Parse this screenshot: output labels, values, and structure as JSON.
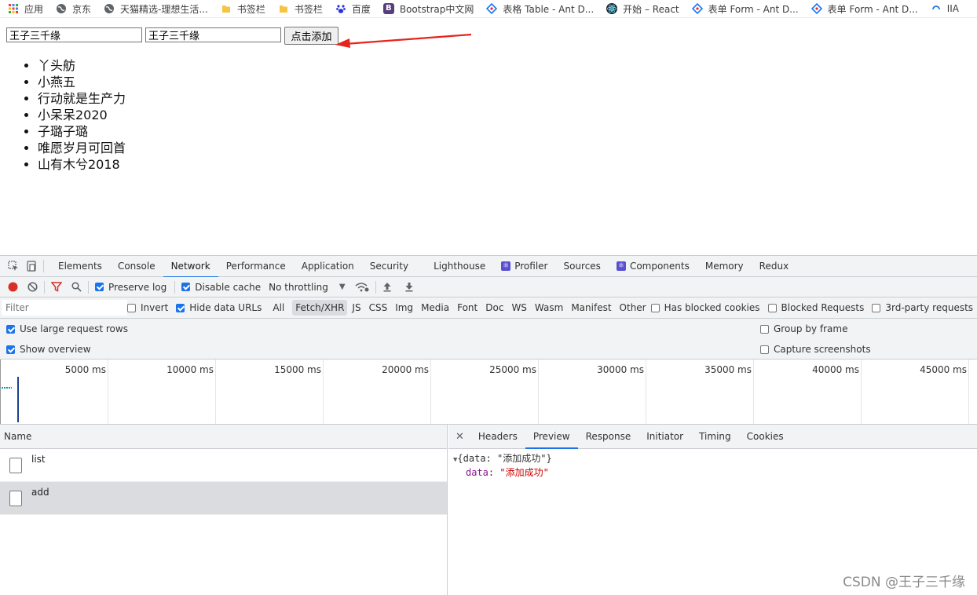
{
  "bookmarks": [
    {
      "label": "应用",
      "icon": "apps-grid-icon"
    },
    {
      "label": "京东",
      "icon": "globe-icon"
    },
    {
      "label": "天猫精选-理想生活...",
      "icon": "globe-icon"
    },
    {
      "label": "书签栏",
      "icon": "folder-icon"
    },
    {
      "label": "书签栏",
      "icon": "folder-icon"
    },
    {
      "label": "百度",
      "icon": "baidu-paw-icon"
    },
    {
      "label": "Bootstrap中文网",
      "icon": "bootstrap-icon"
    },
    {
      "label": "表格 Table - Ant D...",
      "icon": "ant-design-icon"
    },
    {
      "label": "开始 – React",
      "icon": "react-icon"
    },
    {
      "label": "表单 Form - Ant D...",
      "icon": "ant-design-icon"
    },
    {
      "label": "表单 Form - Ant D...",
      "icon": "ant-design-icon"
    },
    {
      "label": "IIA",
      "icon": "loop-icon"
    }
  ],
  "page": {
    "input1_value": "王子三千缘",
    "input2_value": "王子三千缘",
    "add_button": "点击添加",
    "names": [
      "丫头舫",
      "小燕五",
      "行动就是生产力",
      "小呆呆2020",
      "子璐子璐",
      "唯愿岁月可回首",
      "山有木兮2018"
    ]
  },
  "devtools": {
    "tabs": [
      "Elements",
      "Console",
      "Network",
      "Performance",
      "Application",
      "Security",
      "Lighthouse",
      "Profiler",
      "Sources",
      "Components",
      "Memory",
      "Redux"
    ],
    "active_tab": "Network",
    "toolbar": {
      "preserve_log": "Preserve log",
      "disable_cache": "Disable cache",
      "throttling": "No throttling"
    },
    "filter": {
      "placeholder": "Filter",
      "invert": "Invert",
      "hide_data_urls": "Hide data URLs",
      "types": [
        "All",
        "Fetch/XHR",
        "JS",
        "CSS",
        "Img",
        "Media",
        "Font",
        "Doc",
        "WS",
        "Wasm",
        "Manifest",
        "Other"
      ],
      "selected_type": "Fetch/XHR",
      "has_blocked_cookies": "Has blocked cookies",
      "blocked_requests": "Blocked Requests",
      "third_party": "3rd-party requests"
    },
    "options": {
      "large_rows": "Use large request rows",
      "show_overview": "Show overview",
      "group_by_frame": "Group by frame",
      "capture_screenshots": "Capture screenshots"
    },
    "timeline_ticks": [
      "5000 ms",
      "10000 ms",
      "15000 ms",
      "20000 ms",
      "25000 ms",
      "30000 ms",
      "35000 ms",
      "40000 ms",
      "45000 ms"
    ],
    "request_list": {
      "header": "Name",
      "rows": [
        "list",
        "add"
      ],
      "selected": "add"
    },
    "detail_tabs": [
      "Headers",
      "Preview",
      "Response",
      "Initiator",
      "Timing",
      "Cookies"
    ],
    "active_detail_tab": "Preview",
    "preview": {
      "summary": "{data: \"添加成功\"}",
      "key": "data",
      "value": "\"添加成功\""
    }
  },
  "watermark": "CSDN @王子三千缘",
  "colors": {
    "accent": "#1a73e8",
    "record": "#d93025",
    "arrow": "#e8231b"
  }
}
